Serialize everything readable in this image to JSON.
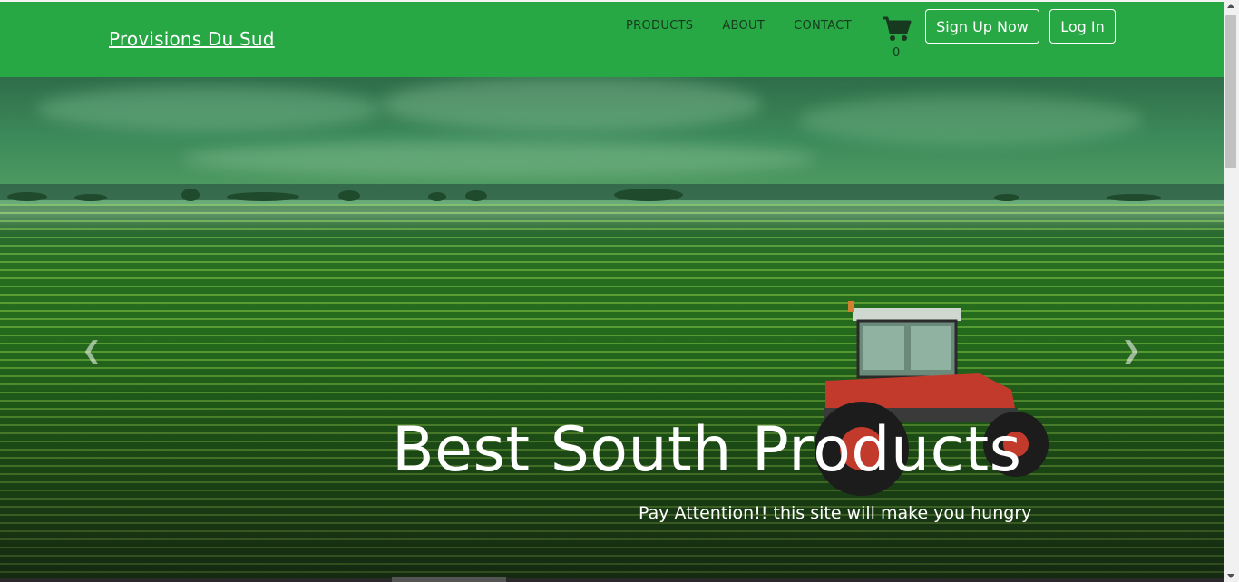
{
  "brand": {
    "name": "Provisions Du Sud"
  },
  "nav": {
    "links": [
      {
        "label": "PRODUCTS"
      },
      {
        "label": "ABOUT"
      },
      {
        "label": "CONTACT"
      }
    ],
    "cart": {
      "icon": "shopping-cart-icon",
      "count": "0"
    },
    "signup_label": "Sign Up Now",
    "login_label": "Log In"
  },
  "hero": {
    "title": "Best South Products",
    "subtitle": "Pay Attention!! this site will make you hungry",
    "prev_icon": "chevron-left-icon",
    "next_icon": "chevron-right-icon",
    "prev_glyph": "❮",
    "next_glyph": "❯"
  },
  "colors": {
    "navbar": "#28a745",
    "nav_text": "#16391f",
    "button_border": "#ffffff"
  }
}
